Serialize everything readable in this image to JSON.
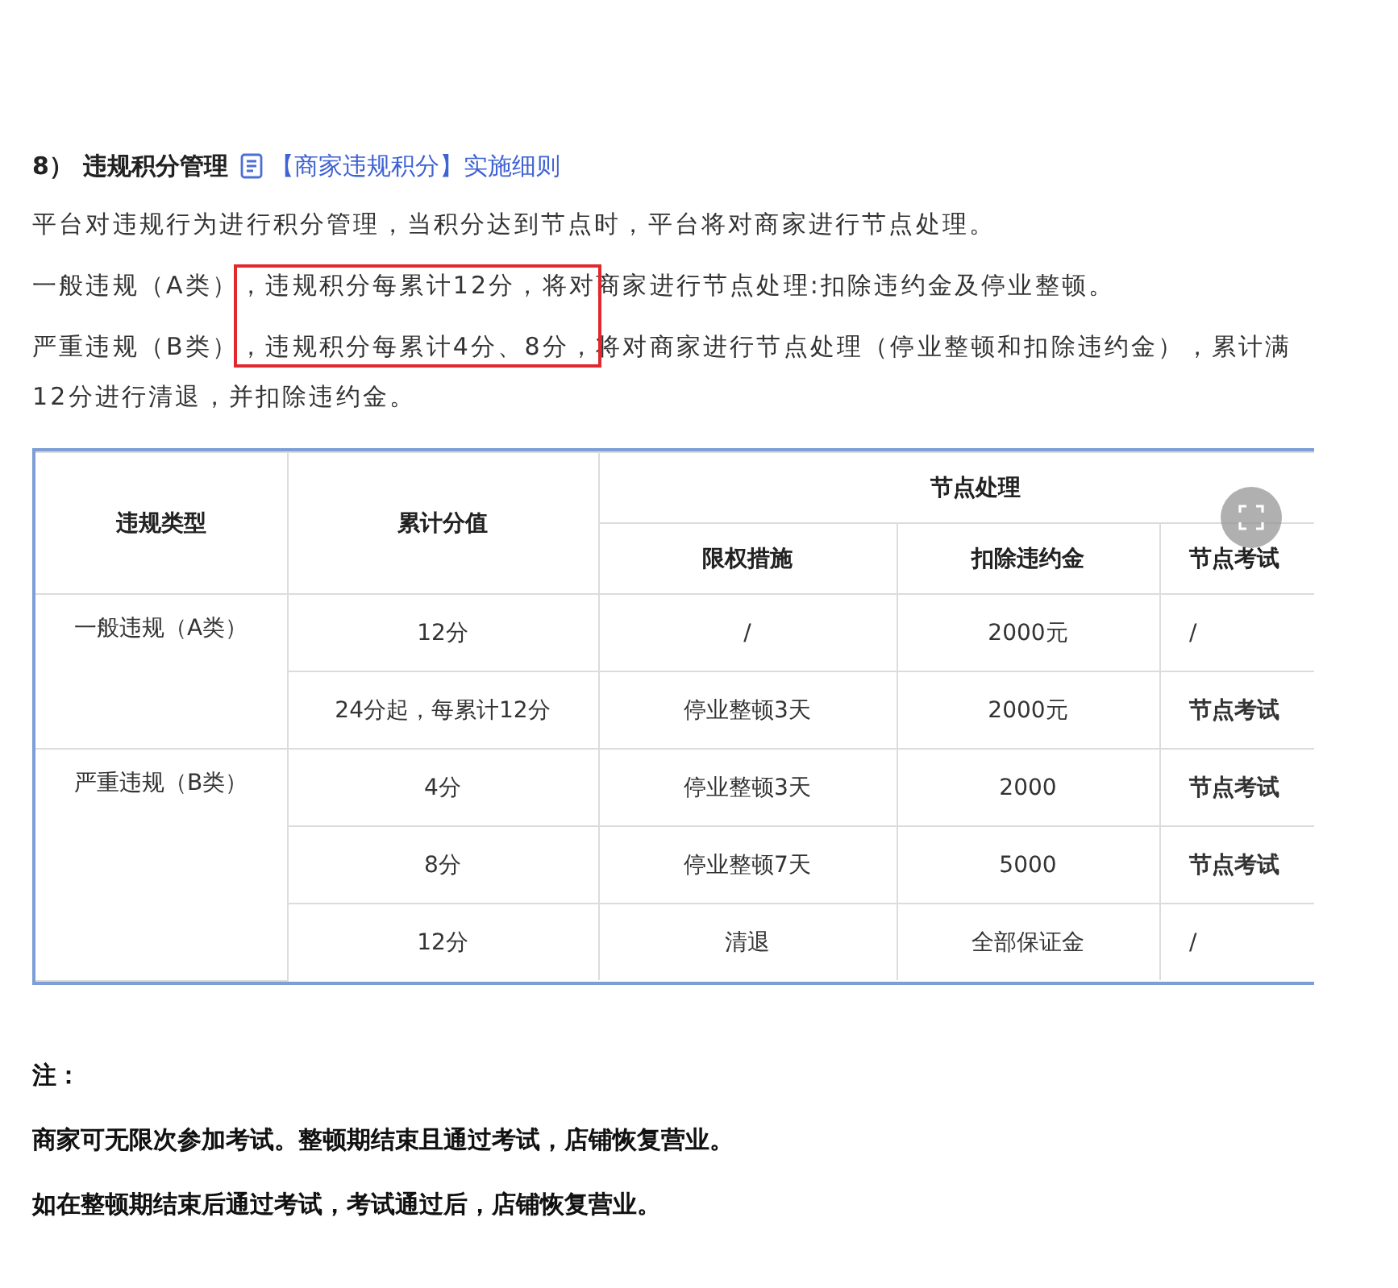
{
  "section": {
    "number": "8）",
    "title": "违规积分管理",
    "link": "【商家违规积分】实施细则"
  },
  "paragraphs": [
    {
      "segments": [
        {
          "text": "平台对违规行为进行积分管理，当积分达到节点时，平台将对商家进行节点处理。",
          "kind": "plain"
        }
      ]
    },
    {
      "segments": [
        {
          "text": "一般违规（A类）",
          "kind": "plain"
        },
        {
          "text": "，违规积分每累计12分，将",
          "kind": "highlight"
        },
        {
          "text": "对商家进行节点处理:扣除违约金及停业整顿。",
          "kind": "plain"
        }
      ]
    },
    {
      "segments": [
        {
          "text": "严重违规（B类）",
          "kind": "plain"
        },
        {
          "text": "，违规积分每累计4分、8分，",
          "kind": "highlight"
        },
        {
          "text": "将对商家进行节点处理（停业整顿和扣除违约金），累计满12分进行清退，并扣除违约金。",
          "kind": "plain"
        }
      ]
    }
  ],
  "table": {
    "columns": [
      {
        "label": "违规类型"
      },
      {
        "label": "累计分值"
      },
      {
        "label": "节点处理",
        "children": [
          {
            "label": "限权措施"
          },
          {
            "label": "扣除违约金"
          },
          {
            "label": "节点考试"
          }
        ]
      }
    ],
    "groups": [
      {
        "type": "一般违规（A类）",
        "rows": [
          [
            {
              "text": "12分",
              "bold": false
            },
            {
              "text": "/",
              "bold": false
            },
            {
              "text": "2000元",
              "bold": false
            },
            {
              "text": "/",
              "bold": false
            }
          ],
          [
            {
              "text": "24分起，每累计12分",
              "bold": false
            },
            {
              "text": "停业整顿3天",
              "bold": false
            },
            {
              "text": "2000元",
              "bold": false
            },
            {
              "text": "节点考试",
              "bold": true
            }
          ]
        ]
      },
      {
        "type": "严重违规（B类）",
        "rows": [
          [
            {
              "text": "4分",
              "bold": false
            },
            {
              "text": "停业整顿3天",
              "bold": false
            },
            {
              "text": "2000",
              "bold": false
            },
            {
              "text": "节点考试",
              "bold": true
            }
          ],
          [
            {
              "text": "8分",
              "bold": false
            },
            {
              "text": "停业整顿7天",
              "bold": false
            },
            {
              "text": "5000",
              "bold": false
            },
            {
              "text": "节点考试",
              "bold": true
            }
          ],
          [
            {
              "text": "12分",
              "bold": false
            },
            {
              "text": "清退",
              "bold": false
            },
            {
              "text": "全部保证金",
              "bold": false
            },
            {
              "text": "/",
              "bold": false
            }
          ]
        ]
      }
    ]
  },
  "notes": {
    "label": "注：",
    "lines": [
      "商家可无限次参加考试。整顿期结束且通过考试，店铺恢复营业。",
      "如在整顿期结束后通过考试，考试通过后，店铺恢复营业。"
    ]
  }
}
